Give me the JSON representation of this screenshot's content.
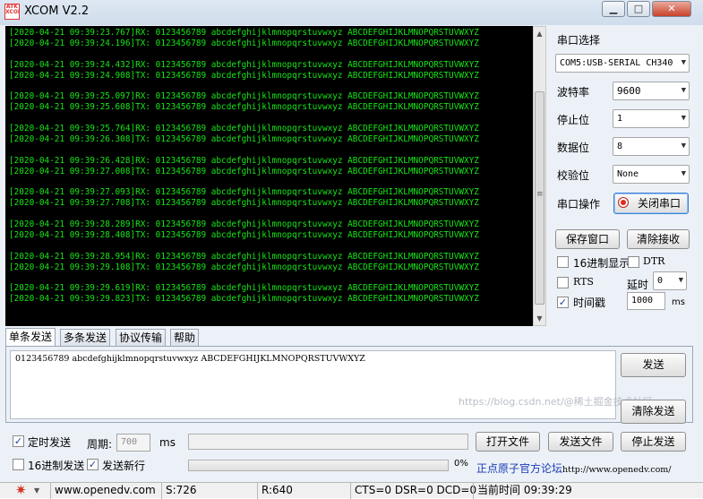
{
  "window": {
    "title": "XCOM V2.2",
    "logo_text": "ATK XCOM",
    "controls": {
      "minimize": "▁",
      "maximize": "□",
      "close": "✕"
    }
  },
  "terminal": {
    "lines": [
      "[2020-04-21 09:39:23.767]RX: 0123456789 abcdefghijklmnopqrstuvwxyz ABCDEFGHIJKLMNOPQRSTUVWXYZ",
      "[2020-04-21 09:39:24.196]TX: 0123456789 abcdefghijklmnopqrstuvwxyz ABCDEFGHIJKLMNOPQRSTUVWXYZ",
      "",
      "[2020-04-21 09:39:24.432]RX: 0123456789 abcdefghijklmnopqrstuvwxyz ABCDEFGHIJKLMNOPQRSTUVWXYZ",
      "[2020-04-21 09:39:24.908]TX: 0123456789 abcdefghijklmnopqrstuvwxyz ABCDEFGHIJKLMNOPQRSTUVWXYZ",
      "",
      "[2020-04-21 09:39:25.097]RX: 0123456789 abcdefghijklmnopqrstuvwxyz ABCDEFGHIJKLMNOPQRSTUVWXYZ",
      "[2020-04-21 09:39:25.608]TX: 0123456789 abcdefghijklmnopqrstuvwxyz ABCDEFGHIJKLMNOPQRSTUVWXYZ",
      "",
      "[2020-04-21 09:39:25.764]RX: 0123456789 abcdefghijklmnopqrstuvwxyz ABCDEFGHIJKLMNOPQRSTUVWXYZ",
      "[2020-04-21 09:39:26.308]TX: 0123456789 abcdefghijklmnopqrstuvwxyz ABCDEFGHIJKLMNOPQRSTUVWXYZ",
      "",
      "[2020-04-21 09:39:26.428]RX: 0123456789 abcdefghijklmnopqrstuvwxyz ABCDEFGHIJKLMNOPQRSTUVWXYZ",
      "[2020-04-21 09:39:27.008]TX: 0123456789 abcdefghijklmnopqrstuvwxyz ABCDEFGHIJKLMNOPQRSTUVWXYZ",
      "",
      "[2020-04-21 09:39:27.093]RX: 0123456789 abcdefghijklmnopqrstuvwxyz ABCDEFGHIJKLMNOPQRSTUVWXYZ",
      "[2020-04-21 09:39:27.708]TX: 0123456789 abcdefghijklmnopqrstuvwxyz ABCDEFGHIJKLMNOPQRSTUVWXYZ",
      "",
      "[2020-04-21 09:39:28.289]RX: 0123456789 abcdefghijklmnopqrstuvwxyz ABCDEFGHIJKLMNOPQRSTUVWXYZ",
      "[2020-04-21 09:39:28.408]TX: 0123456789 abcdefghijklmnopqrstuvwxyz ABCDEFGHIJKLMNOPQRSTUVWXYZ",
      "",
      "[2020-04-21 09:39:28.954]RX: 0123456789 abcdefghijklmnopqrstuvwxyz ABCDEFGHIJKLMNOPQRSTUVWXYZ",
      "[2020-04-21 09:39:29.108]TX: 0123456789 abcdefghijklmnopqrstuvwxyz ABCDEFGHIJKLMNOPQRSTUVWXYZ",
      "",
      "[2020-04-21 09:39:29.619]RX: 0123456789 abcdefghijklmnopqrstuvwxyz ABCDEFGHIJKLMNOPQRSTUVWXYZ",
      "[2020-04-21 09:39:29.823]TX: 0123456789 abcdefghijklmnopqrstuvwxyz ABCDEFGHIJKLMNOPQRSTUVWXYZ"
    ],
    "scroll_up": "▲",
    "scroll_down": "▼",
    "scroll_grip": "≡"
  },
  "settings": {
    "port_label": "串口选择",
    "port_value": "COM5:USB-SERIAL CH340",
    "baud_label": "波特率",
    "baud_value": "9600",
    "stopbits_label": "停止位",
    "stopbits_value": "1",
    "databits_label": "数据位",
    "databits_value": "8",
    "parity_label": "校验位",
    "parity_value": "None",
    "op_label": "串口操作",
    "op_button": "关闭串口",
    "dropdown_arrow": "▼"
  },
  "actions": {
    "save_window": "保存窗口",
    "clear_receive": "清除接收",
    "hex_display": "16进制显示",
    "dtr": "DTR",
    "rts": "RTS",
    "delay_label": "延时",
    "delay_value": "0",
    "timestamp": "时间戳",
    "timestamp_value": "1000",
    "timestamp_unit": "ms",
    "timestamp_checked": "✓"
  },
  "tabs": [
    "单条发送",
    "多条发送",
    "协议传输",
    "帮助"
  ],
  "send": {
    "text": "0123456789 abcdefghijklmnopqrstuvwxyz ABCDEFGHIJKLMNOPQRSTUVWXYZ",
    "send_button": "发送",
    "clear_send_button": "清除发送",
    "watermark": "https://blog.csdn.net/@稀土掘金技术社区"
  },
  "bottom": {
    "timed_send": "定时发送",
    "timed_checked": "✓",
    "period_label": "周期:",
    "period_value": "700",
    "period_unit": "ms",
    "open_file": "打开文件",
    "send_file": "发送文件",
    "stop_send": "停止发送",
    "hex_send": "16进制发送",
    "newline_send": "发送新行",
    "newline_checked": "✓",
    "progress_text": "0%",
    "forum_text": "正点原子官方论坛",
    "forum_url": "http://www.openedv.com/"
  },
  "status": {
    "url": "www.openedv.com",
    "sent": "S:726",
    "received": "R:640",
    "lines": "CTS=0 DSR=0 DCD=0",
    "time": "当前时间 09:39:29",
    "gear_icon": "✷",
    "dropdown": "▼"
  },
  "colors": {
    "terminal_bg": "#000000",
    "terminal_text": "#17e617",
    "forum_link": "#1a3cb5",
    "close_button_red": "#e12b1f"
  }
}
